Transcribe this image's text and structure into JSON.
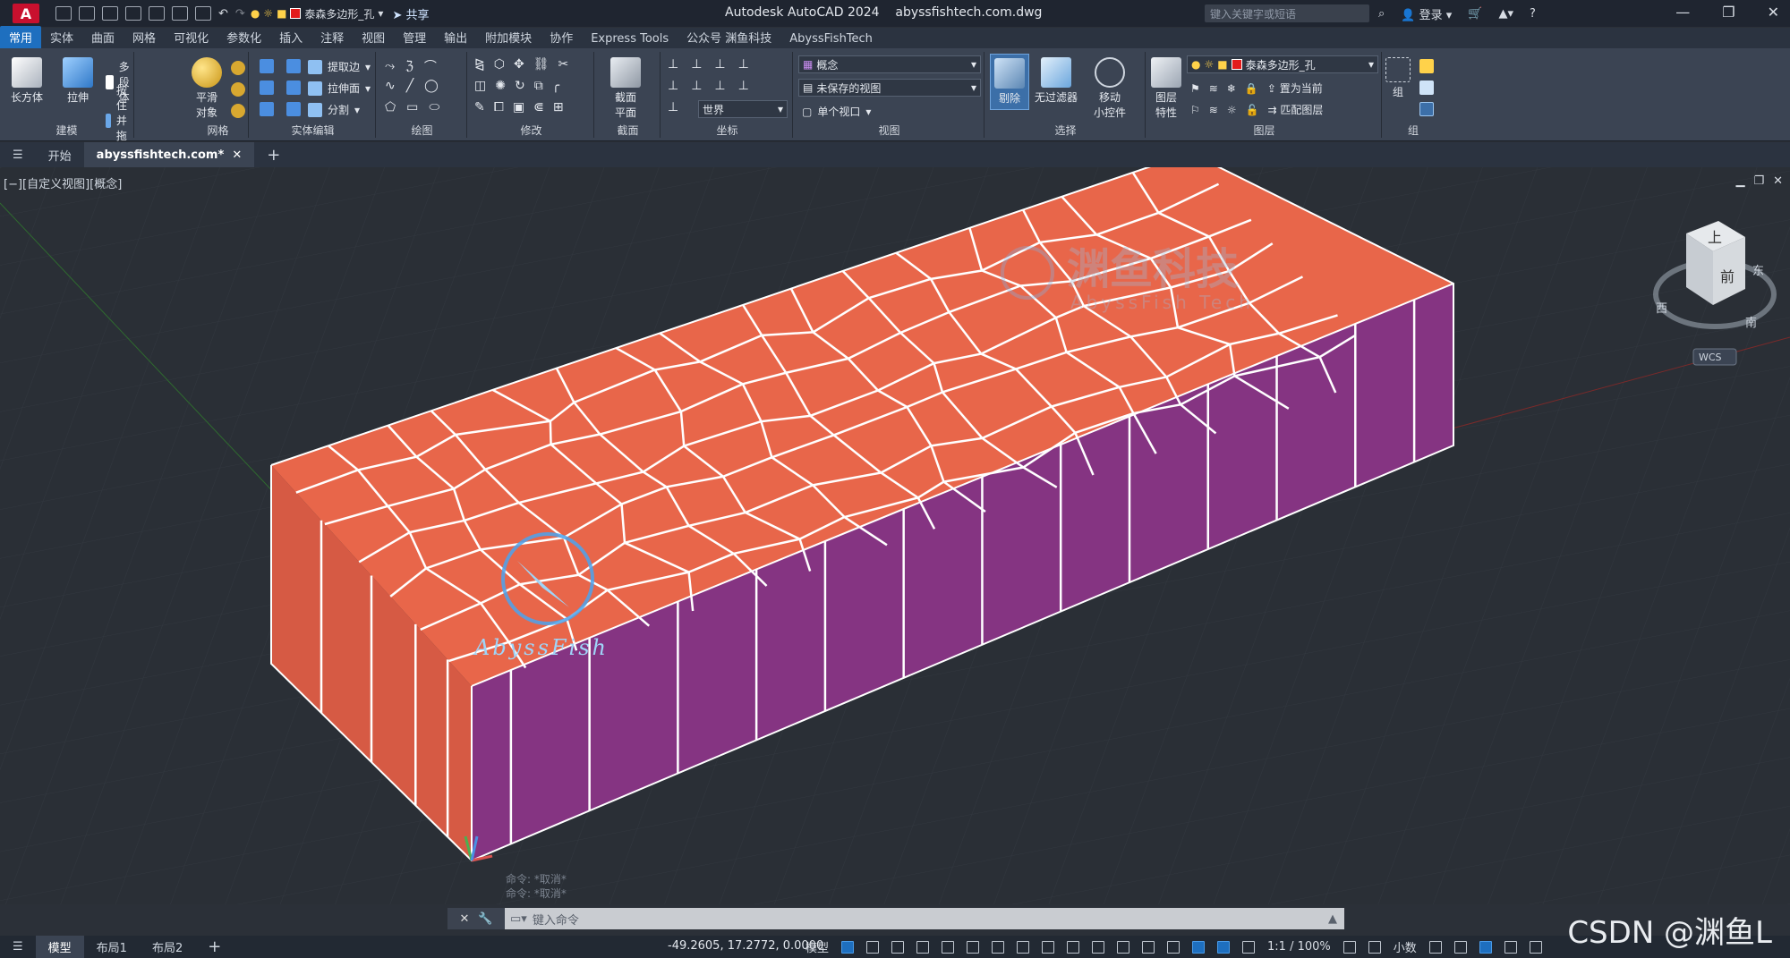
{
  "titlebar": {
    "logo": "A",
    "layer_name": "泰森多边形_孔",
    "share": "共享",
    "app_title": "Autodesk AutoCAD 2024",
    "file_title": "abyssfishtech.com.dwg",
    "search_placeholder": "键入关键字或短语",
    "login": "登录",
    "help": "?"
  },
  "ribbon_tabs": [
    "常用",
    "实体",
    "曲面",
    "网格",
    "可视化",
    "参数化",
    "插入",
    "注释",
    "视图",
    "管理",
    "输出",
    "附加模块",
    "协作",
    "Express Tools",
    "公众号 渊鱼科技",
    "AbyssFishTech"
  ],
  "ribbon": {
    "modeling": {
      "title": "建模",
      "box": "长方体",
      "extrude": "拉伸",
      "polysolid": "多段体",
      "presspull": "按住并拖动"
    },
    "mesh": {
      "title": "网格",
      "smooth": "平滑",
      "smooth2": "对象"
    },
    "solid_edit": {
      "title": "实体编辑",
      "extract": "提取边",
      "extrude_face": "拉伸面",
      "separate": "分割"
    },
    "draw": {
      "title": "绘图"
    },
    "modify": {
      "title": "修改"
    },
    "section": {
      "title": "截面",
      "plane": "截面",
      "plane2": "平面"
    },
    "coords": {
      "title": "坐标",
      "world": "世界"
    },
    "view": {
      "title": "视图",
      "visual_style": "概念",
      "saved_view": "未保存的视图",
      "viewport": "单个视口"
    },
    "selection": {
      "title": "选择",
      "cull": "剔除",
      "nofilter": "无过滤器",
      "gizmo": "移动",
      "gizmo2": "小控件"
    },
    "layers": {
      "title": "图层",
      "props": "图层",
      "props2": "特性",
      "layer": "泰森多边形_孔",
      "set_current": "置为当前",
      "match": "匹配图层"
    },
    "groups": {
      "title": "组",
      "group": "组"
    }
  },
  "doc_tabs": {
    "start": "开始",
    "file": "abyssfishtech.com*"
  },
  "viewport": {
    "label": "[−][自定义视图][概念]",
    "viewcube": {
      "top": "上",
      "front": "前",
      "west": "西",
      "south": "南",
      "east": "东",
      "wcs": "WCS"
    },
    "watermark_cn": "渊鱼科技",
    "watermark_en": "AbyssFish Tech",
    "logo_text": "AbyssFish"
  },
  "command": {
    "history": [
      "命令: *取消*",
      "命令: *取消*"
    ],
    "placeholder": "键入命令"
  },
  "status": {
    "tabs": [
      "模型",
      "布局1",
      "布局2"
    ],
    "coords": "-49.2605, 17.2772, 0.0000",
    "model": "模型",
    "scale": "1:1 / 100%",
    "units": "小数"
  },
  "watermark": "CSDN @渊鱼L",
  "colors": {
    "top_face": "#e8664a",
    "front_face": "#853482",
    "side_face": "#d65a44",
    "edges": "#ffffff",
    "accent": "#1e6fbf"
  }
}
